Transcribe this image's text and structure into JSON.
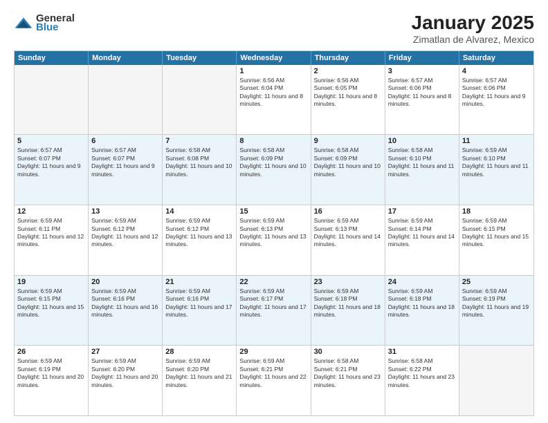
{
  "header": {
    "logo_general": "General",
    "logo_blue": "Blue",
    "title": "January 2025",
    "subtitle": "Zimatlan de Alvarez, Mexico"
  },
  "calendar": {
    "days": [
      "Sunday",
      "Monday",
      "Tuesday",
      "Wednesday",
      "Thursday",
      "Friday",
      "Saturday"
    ],
    "rows": [
      [
        {
          "day": "",
          "empty": true
        },
        {
          "day": "",
          "empty": true
        },
        {
          "day": "",
          "empty": true
        },
        {
          "day": "1",
          "sunrise": "6:56 AM",
          "sunset": "6:04 PM",
          "daylight": "11 hours and 8 minutes."
        },
        {
          "day": "2",
          "sunrise": "6:56 AM",
          "sunset": "6:05 PM",
          "daylight": "11 hours and 8 minutes."
        },
        {
          "day": "3",
          "sunrise": "6:57 AM",
          "sunset": "6:06 PM",
          "daylight": "11 hours and 8 minutes."
        },
        {
          "day": "4",
          "sunrise": "6:57 AM",
          "sunset": "6:06 PM",
          "daylight": "11 hours and 9 minutes."
        }
      ],
      [
        {
          "day": "5",
          "sunrise": "6:57 AM",
          "sunset": "6:07 PM",
          "daylight": "11 hours and 9 minutes."
        },
        {
          "day": "6",
          "sunrise": "6:57 AM",
          "sunset": "6:07 PM",
          "daylight": "11 hours and 9 minutes."
        },
        {
          "day": "7",
          "sunrise": "6:58 AM",
          "sunset": "6:08 PM",
          "daylight": "11 hours and 10 minutes."
        },
        {
          "day": "8",
          "sunrise": "6:58 AM",
          "sunset": "6:09 PM",
          "daylight": "11 hours and 10 minutes."
        },
        {
          "day": "9",
          "sunrise": "6:58 AM",
          "sunset": "6:09 PM",
          "daylight": "11 hours and 10 minutes."
        },
        {
          "day": "10",
          "sunrise": "6:58 AM",
          "sunset": "6:10 PM",
          "daylight": "11 hours and 11 minutes."
        },
        {
          "day": "11",
          "sunrise": "6:59 AM",
          "sunset": "6:10 PM",
          "daylight": "11 hours and 11 minutes."
        }
      ],
      [
        {
          "day": "12",
          "sunrise": "6:59 AM",
          "sunset": "6:11 PM",
          "daylight": "11 hours and 12 minutes."
        },
        {
          "day": "13",
          "sunrise": "6:59 AM",
          "sunset": "6:12 PM",
          "daylight": "11 hours and 12 minutes."
        },
        {
          "day": "14",
          "sunrise": "6:59 AM",
          "sunset": "6:12 PM",
          "daylight": "11 hours and 13 minutes."
        },
        {
          "day": "15",
          "sunrise": "6:59 AM",
          "sunset": "6:13 PM",
          "daylight": "11 hours and 13 minutes."
        },
        {
          "day": "16",
          "sunrise": "6:59 AM",
          "sunset": "6:13 PM",
          "daylight": "11 hours and 14 minutes."
        },
        {
          "day": "17",
          "sunrise": "6:59 AM",
          "sunset": "6:14 PM",
          "daylight": "11 hours and 14 minutes."
        },
        {
          "day": "18",
          "sunrise": "6:59 AM",
          "sunset": "6:15 PM",
          "daylight": "11 hours and 15 minutes."
        }
      ],
      [
        {
          "day": "19",
          "sunrise": "6:59 AM",
          "sunset": "6:15 PM",
          "daylight": "11 hours and 15 minutes."
        },
        {
          "day": "20",
          "sunrise": "6:59 AM",
          "sunset": "6:16 PM",
          "daylight": "11 hours and 16 minutes."
        },
        {
          "day": "21",
          "sunrise": "6:59 AM",
          "sunset": "6:16 PM",
          "daylight": "11 hours and 17 minutes."
        },
        {
          "day": "22",
          "sunrise": "6:59 AM",
          "sunset": "6:17 PM",
          "daylight": "11 hours and 17 minutes."
        },
        {
          "day": "23",
          "sunrise": "6:59 AM",
          "sunset": "6:18 PM",
          "daylight": "11 hours and 18 minutes."
        },
        {
          "day": "24",
          "sunrise": "6:59 AM",
          "sunset": "6:18 PM",
          "daylight": "11 hours and 18 minutes."
        },
        {
          "day": "25",
          "sunrise": "6:59 AM",
          "sunset": "6:19 PM",
          "daylight": "11 hours and 19 minutes."
        }
      ],
      [
        {
          "day": "26",
          "sunrise": "6:59 AM",
          "sunset": "6:19 PM",
          "daylight": "11 hours and 20 minutes."
        },
        {
          "day": "27",
          "sunrise": "6:59 AM",
          "sunset": "6:20 PM",
          "daylight": "11 hours and 20 minutes."
        },
        {
          "day": "28",
          "sunrise": "6:59 AM",
          "sunset": "6:20 PM",
          "daylight": "11 hours and 21 minutes."
        },
        {
          "day": "29",
          "sunrise": "6:59 AM",
          "sunset": "6:21 PM",
          "daylight": "11 hours and 22 minutes."
        },
        {
          "day": "30",
          "sunrise": "6:58 AM",
          "sunset": "6:21 PM",
          "daylight": "11 hours and 23 minutes."
        },
        {
          "day": "31",
          "sunrise": "6:58 AM",
          "sunset": "6:22 PM",
          "daylight": "11 hours and 23 minutes."
        },
        {
          "day": "",
          "empty": true
        }
      ]
    ]
  }
}
